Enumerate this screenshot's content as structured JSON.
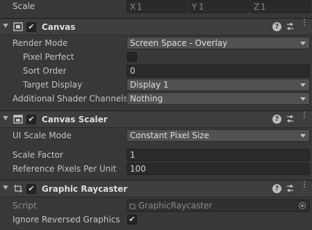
{
  "transform": {
    "scale_label": "Scale",
    "x_label": "X",
    "x_value": "1",
    "y_label": "Y",
    "y_value": "1",
    "z_label": "Z",
    "z_value": "1"
  },
  "canvas": {
    "title": "Canvas",
    "render_mode_label": "Render Mode",
    "render_mode_value": "Screen Space - Overlay",
    "pixel_perfect_label": "Pixel Perfect",
    "sort_order_label": "Sort Order",
    "sort_order_value": "0",
    "target_display_label": "Target Display",
    "target_display_value": "Display 1",
    "shader_channels_label": "Additional Shader Channels",
    "shader_channels_value": "Nothing"
  },
  "canvas_scaler": {
    "title": "Canvas Scaler",
    "ui_scale_mode_label": "UI Scale Mode",
    "ui_scale_mode_value": "Constant Pixel Size",
    "scale_factor_label": "Scale Factor",
    "scale_factor_value": "1",
    "ref_ppu_label": "Reference Pixels Per Unit",
    "ref_ppu_value": "100"
  },
  "graphic_raycaster": {
    "title": "Graphic Raycaster",
    "script_label": "Script",
    "script_value": "GraphicRaycaster",
    "ignore_reversed_label": "Ignore Reversed Graphics"
  },
  "header_icons": {
    "help": "?",
    "more": "⋮"
  },
  "colors": {
    "background": "#383838",
    "header": "#3e3e3e",
    "field": "#2a2a2a",
    "dropdown": "#515151",
    "text": "#c4c4c4"
  }
}
